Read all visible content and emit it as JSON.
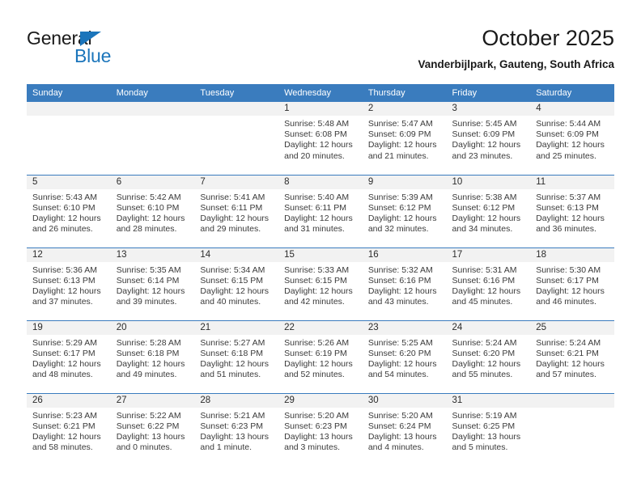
{
  "brand": {
    "name_top": "General",
    "name_bottom": "Blue",
    "triangle_icon": "brand-triangle-icon",
    "accent_color": "#1b75bb"
  },
  "header": {
    "title": "October 2025",
    "subtitle": "Vanderbijlpark, Gauteng, South Africa"
  },
  "theme": {
    "header_row_bg": "#3a7cbe",
    "daynum_strip_bg": "#f2f2f2",
    "row_divider": "#3a7cbe",
    "text": "#3a3a3a"
  },
  "calendar": {
    "weekday_headers": [
      "Sunday",
      "Monday",
      "Tuesday",
      "Wednesday",
      "Thursday",
      "Friday",
      "Saturday"
    ],
    "labels": {
      "sunrise": "Sunrise:",
      "sunset": "Sunset:",
      "daylight": "Daylight:"
    },
    "weeks": [
      [
        {
          "day": "",
          "empty": true
        },
        {
          "day": "",
          "empty": true
        },
        {
          "day": "",
          "empty": true
        },
        {
          "day": "1",
          "sunrise": "Sunrise: 5:48 AM",
          "sunset": "Sunset: 6:08 PM",
          "daylight_line1": "Daylight: 12 hours",
          "daylight_line2": "and 20 minutes."
        },
        {
          "day": "2",
          "sunrise": "Sunrise: 5:47 AM",
          "sunset": "Sunset: 6:09 PM",
          "daylight_line1": "Daylight: 12 hours",
          "daylight_line2": "and 21 minutes."
        },
        {
          "day": "3",
          "sunrise": "Sunrise: 5:45 AM",
          "sunset": "Sunset: 6:09 PM",
          "daylight_line1": "Daylight: 12 hours",
          "daylight_line2": "and 23 minutes."
        },
        {
          "day": "4",
          "sunrise": "Sunrise: 5:44 AM",
          "sunset": "Sunset: 6:09 PM",
          "daylight_line1": "Daylight: 12 hours",
          "daylight_line2": "and 25 minutes."
        }
      ],
      [
        {
          "day": "5",
          "sunrise": "Sunrise: 5:43 AM",
          "sunset": "Sunset: 6:10 PM",
          "daylight_line1": "Daylight: 12 hours",
          "daylight_line2": "and 26 minutes."
        },
        {
          "day": "6",
          "sunrise": "Sunrise: 5:42 AM",
          "sunset": "Sunset: 6:10 PM",
          "daylight_line1": "Daylight: 12 hours",
          "daylight_line2": "and 28 minutes."
        },
        {
          "day": "7",
          "sunrise": "Sunrise: 5:41 AM",
          "sunset": "Sunset: 6:11 PM",
          "daylight_line1": "Daylight: 12 hours",
          "daylight_line2": "and 29 minutes."
        },
        {
          "day": "8",
          "sunrise": "Sunrise: 5:40 AM",
          "sunset": "Sunset: 6:11 PM",
          "daylight_line1": "Daylight: 12 hours",
          "daylight_line2": "and 31 minutes."
        },
        {
          "day": "9",
          "sunrise": "Sunrise: 5:39 AM",
          "sunset": "Sunset: 6:12 PM",
          "daylight_line1": "Daylight: 12 hours",
          "daylight_line2": "and 32 minutes."
        },
        {
          "day": "10",
          "sunrise": "Sunrise: 5:38 AM",
          "sunset": "Sunset: 6:12 PM",
          "daylight_line1": "Daylight: 12 hours",
          "daylight_line2": "and 34 minutes."
        },
        {
          "day": "11",
          "sunrise": "Sunrise: 5:37 AM",
          "sunset": "Sunset: 6:13 PM",
          "daylight_line1": "Daylight: 12 hours",
          "daylight_line2": "and 36 minutes."
        }
      ],
      [
        {
          "day": "12",
          "sunrise": "Sunrise: 5:36 AM",
          "sunset": "Sunset: 6:13 PM",
          "daylight_line1": "Daylight: 12 hours",
          "daylight_line2": "and 37 minutes."
        },
        {
          "day": "13",
          "sunrise": "Sunrise: 5:35 AM",
          "sunset": "Sunset: 6:14 PM",
          "daylight_line1": "Daylight: 12 hours",
          "daylight_line2": "and 39 minutes."
        },
        {
          "day": "14",
          "sunrise": "Sunrise: 5:34 AM",
          "sunset": "Sunset: 6:15 PM",
          "daylight_line1": "Daylight: 12 hours",
          "daylight_line2": "and 40 minutes."
        },
        {
          "day": "15",
          "sunrise": "Sunrise: 5:33 AM",
          "sunset": "Sunset: 6:15 PM",
          "daylight_line1": "Daylight: 12 hours",
          "daylight_line2": "and 42 minutes."
        },
        {
          "day": "16",
          "sunrise": "Sunrise: 5:32 AM",
          "sunset": "Sunset: 6:16 PM",
          "daylight_line1": "Daylight: 12 hours",
          "daylight_line2": "and 43 minutes."
        },
        {
          "day": "17",
          "sunrise": "Sunrise: 5:31 AM",
          "sunset": "Sunset: 6:16 PM",
          "daylight_line1": "Daylight: 12 hours",
          "daylight_line2": "and 45 minutes."
        },
        {
          "day": "18",
          "sunrise": "Sunrise: 5:30 AM",
          "sunset": "Sunset: 6:17 PM",
          "daylight_line1": "Daylight: 12 hours",
          "daylight_line2": "and 46 minutes."
        }
      ],
      [
        {
          "day": "19",
          "sunrise": "Sunrise: 5:29 AM",
          "sunset": "Sunset: 6:17 PM",
          "daylight_line1": "Daylight: 12 hours",
          "daylight_line2": "and 48 minutes."
        },
        {
          "day": "20",
          "sunrise": "Sunrise: 5:28 AM",
          "sunset": "Sunset: 6:18 PM",
          "daylight_line1": "Daylight: 12 hours",
          "daylight_line2": "and 49 minutes."
        },
        {
          "day": "21",
          "sunrise": "Sunrise: 5:27 AM",
          "sunset": "Sunset: 6:18 PM",
          "daylight_line1": "Daylight: 12 hours",
          "daylight_line2": "and 51 minutes."
        },
        {
          "day": "22",
          "sunrise": "Sunrise: 5:26 AM",
          "sunset": "Sunset: 6:19 PM",
          "daylight_line1": "Daylight: 12 hours",
          "daylight_line2": "and 52 minutes."
        },
        {
          "day": "23",
          "sunrise": "Sunrise: 5:25 AM",
          "sunset": "Sunset: 6:20 PM",
          "daylight_line1": "Daylight: 12 hours",
          "daylight_line2": "and 54 minutes."
        },
        {
          "day": "24",
          "sunrise": "Sunrise: 5:24 AM",
          "sunset": "Sunset: 6:20 PM",
          "daylight_line1": "Daylight: 12 hours",
          "daylight_line2": "and 55 minutes."
        },
        {
          "day": "25",
          "sunrise": "Sunrise: 5:24 AM",
          "sunset": "Sunset: 6:21 PM",
          "daylight_line1": "Daylight: 12 hours",
          "daylight_line2": "and 57 minutes."
        }
      ],
      [
        {
          "day": "26",
          "sunrise": "Sunrise: 5:23 AM",
          "sunset": "Sunset: 6:21 PM",
          "daylight_line1": "Daylight: 12 hours",
          "daylight_line2": "and 58 minutes."
        },
        {
          "day": "27",
          "sunrise": "Sunrise: 5:22 AM",
          "sunset": "Sunset: 6:22 PM",
          "daylight_line1": "Daylight: 13 hours",
          "daylight_line2": "and 0 minutes."
        },
        {
          "day": "28",
          "sunrise": "Sunrise: 5:21 AM",
          "sunset": "Sunset: 6:23 PM",
          "daylight_line1": "Daylight: 13 hours",
          "daylight_line2": "and 1 minute."
        },
        {
          "day": "29",
          "sunrise": "Sunrise: 5:20 AM",
          "sunset": "Sunset: 6:23 PM",
          "daylight_line1": "Daylight: 13 hours",
          "daylight_line2": "and 3 minutes."
        },
        {
          "day": "30",
          "sunrise": "Sunrise: 5:20 AM",
          "sunset": "Sunset: 6:24 PM",
          "daylight_line1": "Daylight: 13 hours",
          "daylight_line2": "and 4 minutes."
        },
        {
          "day": "31",
          "sunrise": "Sunrise: 5:19 AM",
          "sunset": "Sunset: 6:25 PM",
          "daylight_line1": "Daylight: 13 hours",
          "daylight_line2": "and 5 minutes."
        },
        {
          "day": "",
          "empty": true
        }
      ]
    ]
  }
}
